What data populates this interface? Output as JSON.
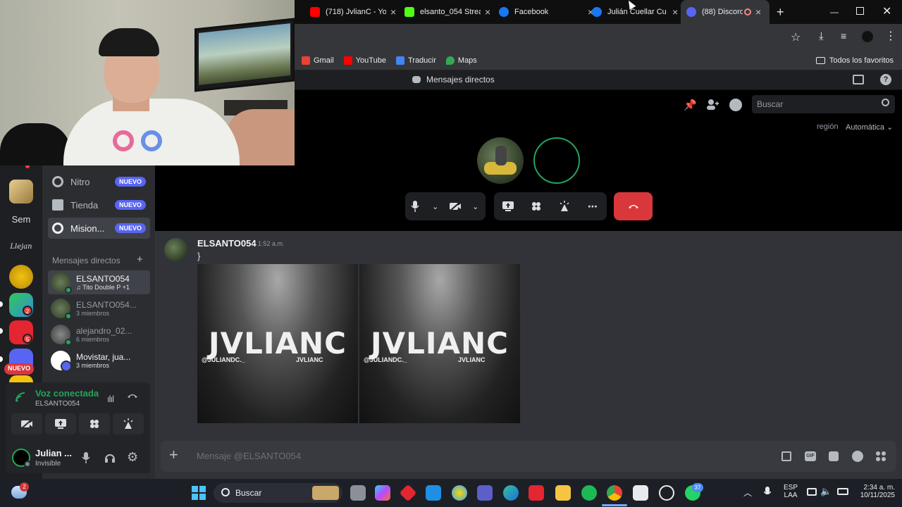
{
  "browser": {
    "tabs": [
      {
        "title": "(718) JvlianC - Yo",
        "color": "#ff0000"
      },
      {
        "title": "elsanto_054 Strea",
        "color": "#53fc18"
      },
      {
        "title": "Facebook",
        "color": "#1877f2"
      },
      {
        "title": "Julián Cuellar Cu",
        "color": "#1877f2"
      },
      {
        "title": "(88) Discord",
        "color": "#5865f2",
        "badge": "88"
      }
    ],
    "new_tab": "+",
    "bookmarks": [
      {
        "label": "Gmail",
        "color": "#ea4335"
      },
      {
        "label": "YouTube",
        "color": "#ff0000"
      },
      {
        "label": "Traducir",
        "color": "#4285f4"
      },
      {
        "label": "Maps",
        "color": "#34a853"
      }
    ],
    "all_bookmarks": "Todos los favoritos"
  },
  "discord": {
    "header_title": "Mensajes directos",
    "search_placeholder": "Buscar",
    "region_label": "región",
    "region_value": "Automática",
    "servers": [
      {
        "label": "",
        "color": "#c9a86a"
      },
      {
        "label": "Sem",
        "color": "#1e1f22"
      },
      {
        "label": "Llejan",
        "color": "#1e1f22"
      },
      {
        "label": "",
        "color": "#d9a514"
      },
      {
        "label": "",
        "color": "#2f8fd6",
        "badge": "2"
      },
      {
        "label": "",
        "color": "#e3262f",
        "badge": "5"
      },
      {
        "label": "",
        "color": "#5865f2"
      }
    ],
    "nuevo_pill": "NUEVO",
    "nav": [
      {
        "label": "Nitro",
        "badge": "NUEVO"
      },
      {
        "label": "Tienda",
        "badge": "NUEVO"
      },
      {
        "label": "Mision...",
        "badge": "NUEVO"
      }
    ],
    "dm_header": "Mensajes directos",
    "dm_add": "+",
    "dms": [
      {
        "name": "ELSANTO054",
        "sub": "♫ Tito Double P +1"
      },
      {
        "name": "ELSANTO054...",
        "sub": "3 miembros"
      },
      {
        "name": "alejandro_02...",
        "sub": "6 miembros"
      },
      {
        "name": "Movistar, jua...",
        "sub": "3 miembros"
      }
    ],
    "voice": {
      "status": "Voz conectada",
      "channel": "ELSANTO054"
    },
    "user": {
      "name": "Julian ...",
      "status": "Invisible"
    },
    "message": {
      "author": "ELSANTO054",
      "time": "1:52 a.m.",
      "text": "}",
      "images": [
        {
          "brand": "JVLIANC",
          "handle1": "@JULIANDC._",
          "handle2": "JVLIANC"
        },
        {
          "brand": "JVLIANC",
          "handle1": "@JULIANDC._",
          "handle2": "JVLIANC"
        }
      ]
    },
    "composer_placeholder": "Mensaje @ELSANTO054"
  },
  "taskbar": {
    "search": "Buscar",
    "lang_top": "ESP",
    "lang_bottom": "LAA",
    "time": "2:34 a. m.",
    "date": "10/11/2025",
    "weather_badge": "2",
    "whatsapp_badge": "37"
  },
  "colors": {
    "accent": "#5865f2",
    "danger": "#da373c",
    "online": "#23a55a"
  }
}
